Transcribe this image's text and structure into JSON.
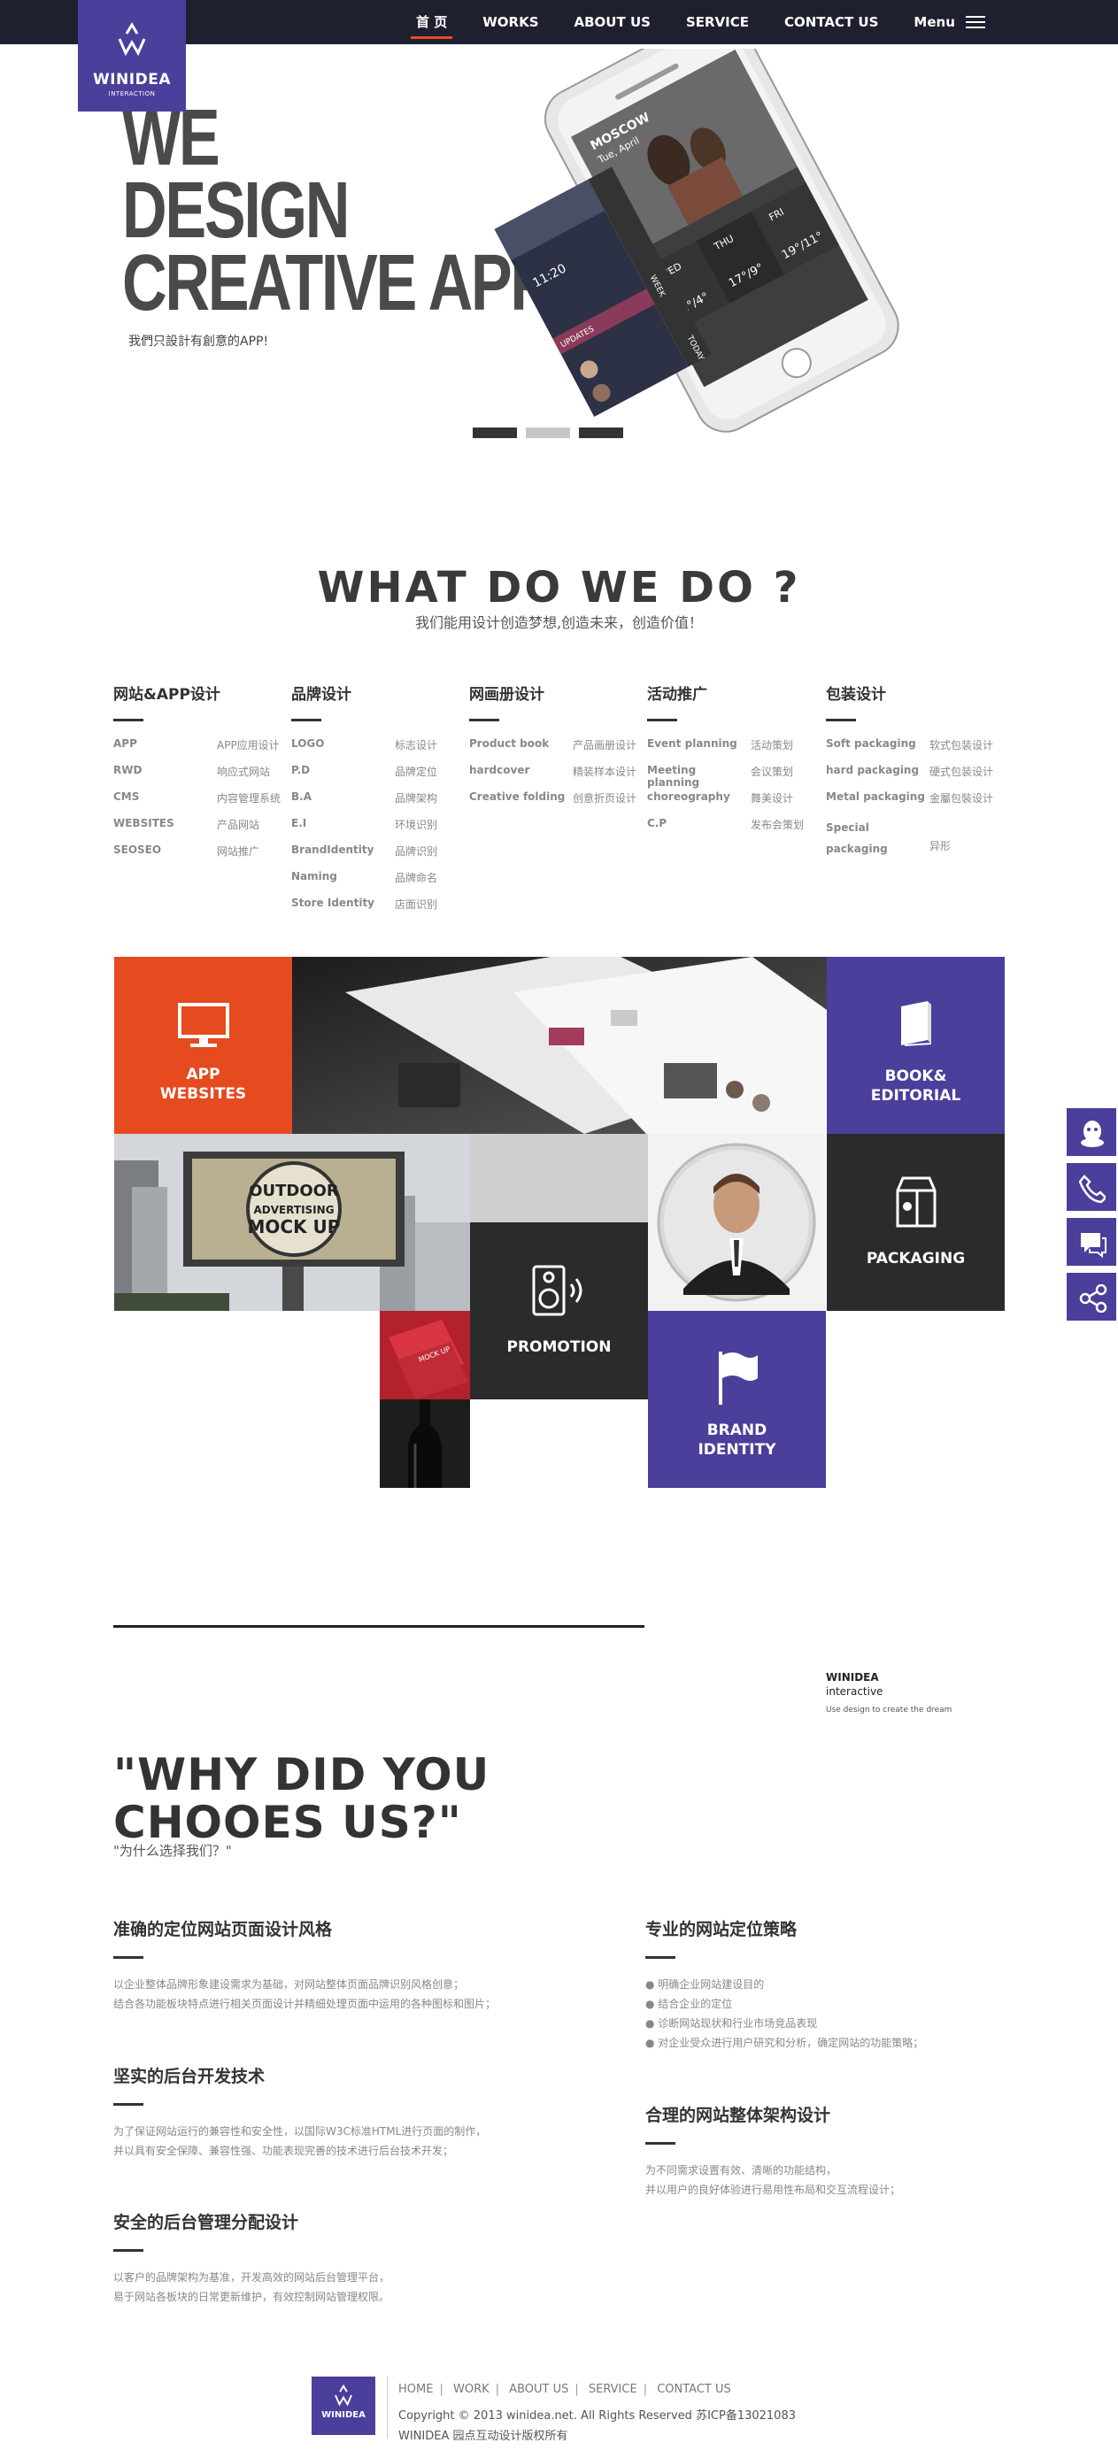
{
  "nav": {
    "logo_name": "WINIDEA",
    "logo_sub": "INTERACTION",
    "items": [
      {
        "label": "首 页"
      },
      {
        "label": "WORKS"
      },
      {
        "label": "ABOUT US"
      },
      {
        "label": "SERVICE"
      },
      {
        "label": "CONTACT US"
      }
    ],
    "menu_label": "Menu"
  },
  "hero": {
    "line1": "WE",
    "line2": "DESIGN",
    "line3": "CREATIVE APP",
    "subtitle": "我們只設計有創意的APP!",
    "phone_texts": {
      "city": "MOSCOW",
      "date": "Tue, April",
      "wed": "WED",
      "thu": "THU",
      "fri": "FRI",
      "t1": "11°/4°",
      "t2": "17°/9°",
      "t3": "19°/11°",
      "time": "11:20",
      "update": "UPDATES",
      "today": "TODAY",
      "week": "WEEK"
    },
    "slides_active": [
      true,
      false,
      true
    ]
  },
  "whatwedo": {
    "title": "WHAT DO WE DO ?",
    "subtitle": "我们能用设计创造梦想,创造未来，创造价值！",
    "columns": [
      {
        "title": "网站&APP设计",
        "rows": [
          {
            "en": "APP",
            "cn": "APP应用设计"
          },
          {
            "en": "RWD",
            "cn": "响应式网站"
          },
          {
            "en": "CMS",
            "cn": "内容管理系统"
          },
          {
            "en": "WEBSITES",
            "cn": "产品网站"
          },
          {
            "en": "SEOSEO",
            "cn": "网站推广"
          }
        ]
      },
      {
        "title": "品牌设计",
        "rows": [
          {
            "en": "LOGO",
            "cn": "标志设计"
          },
          {
            "en": "P.D",
            "cn": "品牌定位"
          },
          {
            "en": "B.A",
            "cn": "品牌架构"
          },
          {
            "en": "E.I",
            "cn": "环境识别"
          },
          {
            "en": "BrandIdentity",
            "cn": "品牌识别"
          },
          {
            "en": "Naming",
            "cn": "品牌命名"
          },
          {
            "en": "Store Identity",
            "cn": "店面识别"
          }
        ]
      },
      {
        "title": "网画册设计",
        "rows": [
          {
            "en": "Product book",
            "cn": "产品画册设计"
          },
          {
            "en": "hardcover",
            "cn": "精装样本设计"
          },
          {
            "en": "Creative folding",
            "cn": "创意折页设计"
          }
        ]
      },
      {
        "title": "活动推广",
        "rows": [
          {
            "en": "Event planning",
            "cn": "活动策划"
          },
          {
            "en": "Meeting planning",
            "cn": "会议策划"
          },
          {
            "en": "choreography",
            "cn": "舞美设计"
          },
          {
            "en": "C.P",
            "cn": "发布会策划"
          }
        ]
      },
      {
        "title": "包装设计",
        "rows": [
          {
            "en": "Soft packaging",
            "cn": "软式包装设计"
          },
          {
            "en": "hard packaging",
            "cn": "硬式包装设计"
          },
          {
            "en": "Metal packaging",
            "cn": "金屬包裝设计"
          },
          {
            "en": "Special packaging",
            "cn": "异形"
          }
        ]
      }
    ]
  },
  "grid": {
    "app_line1": "APP",
    "app_line2": "WEBSITES",
    "book_line1": "BOOK&",
    "book_line2": "EDITORIAL",
    "billboard_line1": "OUTDOOR",
    "billboard_line2": "ADVERTISING",
    "billboard_line3": "MOCK UP",
    "mockup_label": "MOCK UP",
    "packaging": "PACKAGING",
    "promotion": "PROMOTION",
    "brand_line1": "BRAND",
    "brand_line2": "IDENTITY"
  },
  "why": {
    "brand_name": "WINIDEA",
    "brand_sub": "interactive",
    "brand_tag": "Use design to create the dream",
    "title_line1": "\"WHY DID YOU",
    "title_line2": "CHOOES US?\"",
    "subtitle": "\"为什么选择我们？\"",
    "items": [
      {
        "title": "准确的定位网站页面设计风格",
        "lines": [
          "以企业整体品牌形象建设需求为基础，对网站整体页面品牌识别风格创意；",
          "结合各功能板块特点进行相关页面设计并精细处理页面中运用的各种图标和图片；"
        ]
      },
      {
        "title": "坚实的后台开发技术",
        "lines": [
          "为了保证网站运行的兼容性和安全性，以国际W3C标准HTML进行页面的制作，",
          "并以具有安全保障、兼容性强、功能表现完善的技术进行后台技术开发；"
        ]
      },
      {
        "title": "安全的后台管理分配设计",
        "lines": [
          "以客户的品牌架构为基准，开发高效的网站后台管理平台，",
          "易于网站各板块的日常更新维护，有效控制网站管理权限。"
        ]
      },
      {
        "title": "专业的网站定位策略",
        "lines": [
          "● 明确企业网站建设目的",
          "● 结合企业的定位",
          "● 诊断网站现状和行业市场竞品表现",
          "● 对企业受众进行用户研究和分析，确定网站的功能策略；"
        ]
      },
      {
        "title": "合理的网站整体架构设计",
        "lines": [
          "为不同需求设置有效、清晰的功能结构，",
          "并以用户的良好体验进行易用性布局和交互流程设计；"
        ]
      }
    ]
  },
  "footer": {
    "logo_name": "WINIDEA",
    "links": [
      "HOME",
      "WORK",
      "ABOUT US",
      "SERVICE",
      "CONTACT US"
    ],
    "copyright": "Copyright © 2013 winidea.net. All Rights Reserved 苏ICP备13021083",
    "company": "WINIDEA 园点互动设计版权所有"
  },
  "float_icons": [
    "qq-icon",
    "phone-icon",
    "chat-icon",
    "share-icon"
  ],
  "colors": {
    "nav_bg": "#1e2030",
    "brand_purple": "#4a3f9a",
    "accent_orange": "#e64a1f",
    "dark_tile": "#2b2b2b"
  }
}
